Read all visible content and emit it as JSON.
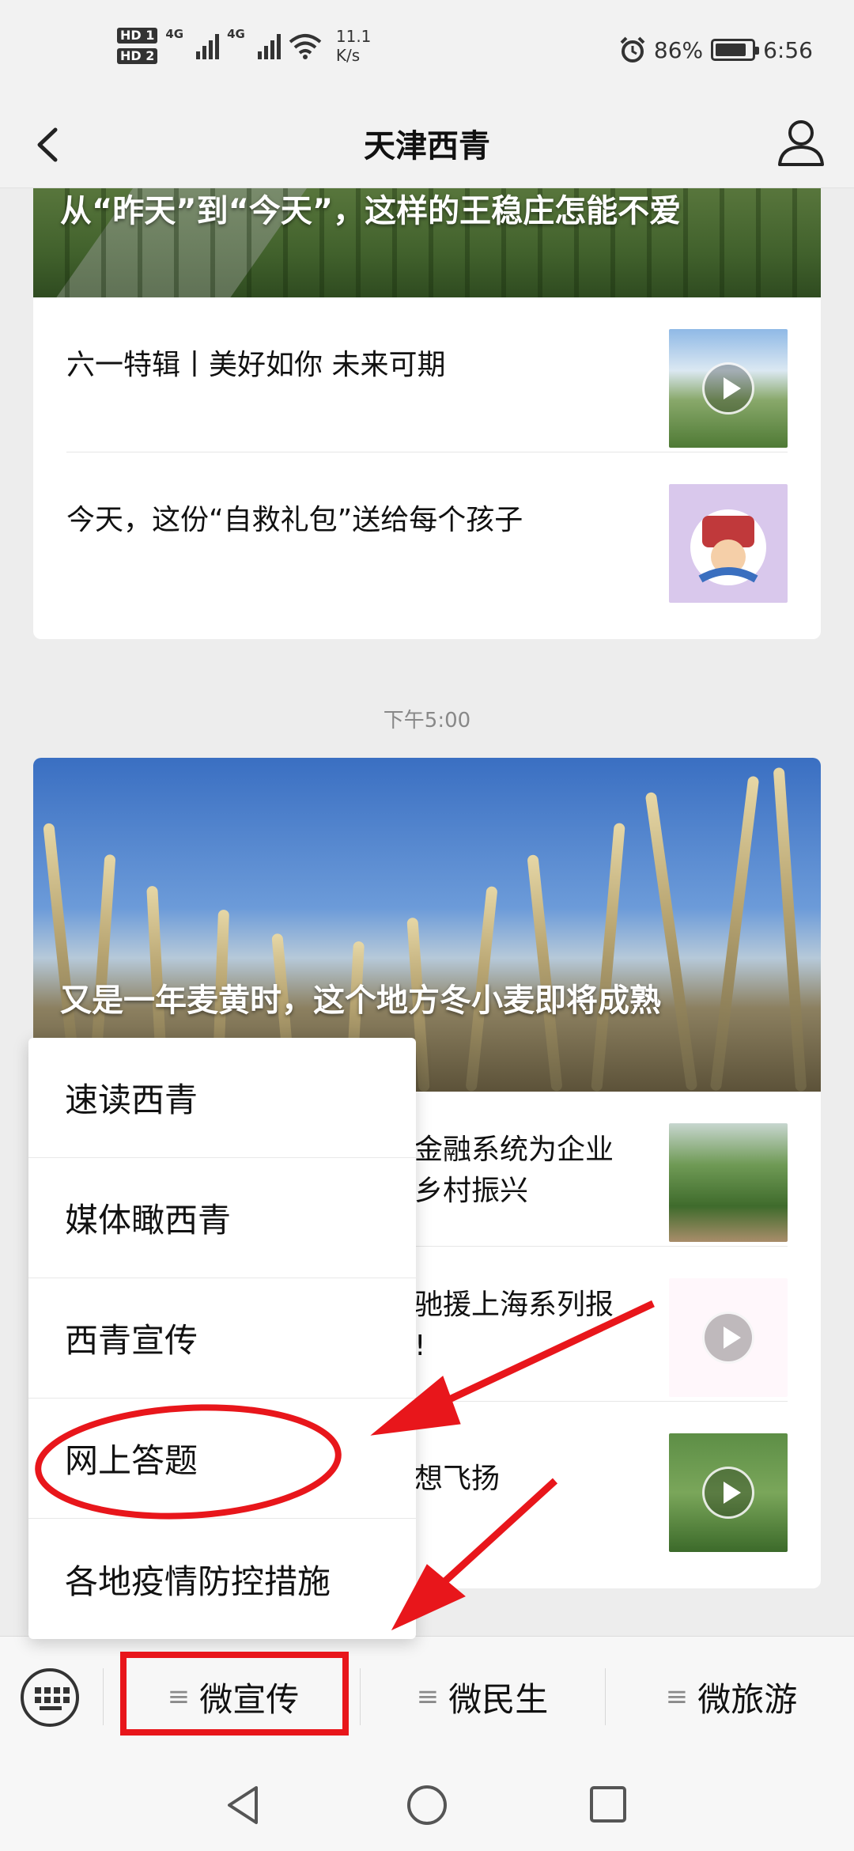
{
  "status_bar": {
    "hd1": "HD 1",
    "hd2": "HD 2",
    "net1": "4G",
    "net2": "4G",
    "speed_value": "11.1",
    "speed_unit": "K/s",
    "battery_pct": "86%",
    "battery_level": 0.86,
    "time": "6:56"
  },
  "nav": {
    "title": "天津西青"
  },
  "feed": {
    "card1": {
      "cover_title": "从“昨天”到“今天”，这样的王稳庄怎能不爱",
      "items": [
        {
          "title": "六一特辑丨美好如你 未来可期"
        },
        {
          "title": "今天，这份“自救礼包”送给每个孩子"
        }
      ]
    },
    "timestamp": "下午5:00",
    "card2": {
      "cover_title": "又是一年麦黄时，这个地方冬小麦即将成熟",
      "items": [
        {
          "title": "金融系统为企业\n乡村振兴"
        },
        {
          "title": "驰援上海系列报\n!"
        },
        {
          "title": "想飞扬"
        }
      ]
    }
  },
  "popup_menu": {
    "items": [
      "速读西青",
      "媒体瞰西青",
      "西青宣传",
      "网上答题",
      "各地疫情防控措施"
    ]
  },
  "bottom_menu": {
    "items": [
      "微宣传",
      "微民生",
      "微旅游"
    ]
  },
  "colors": {
    "annotation_red": "#e8161b",
    "page_bg": "#ededed"
  }
}
